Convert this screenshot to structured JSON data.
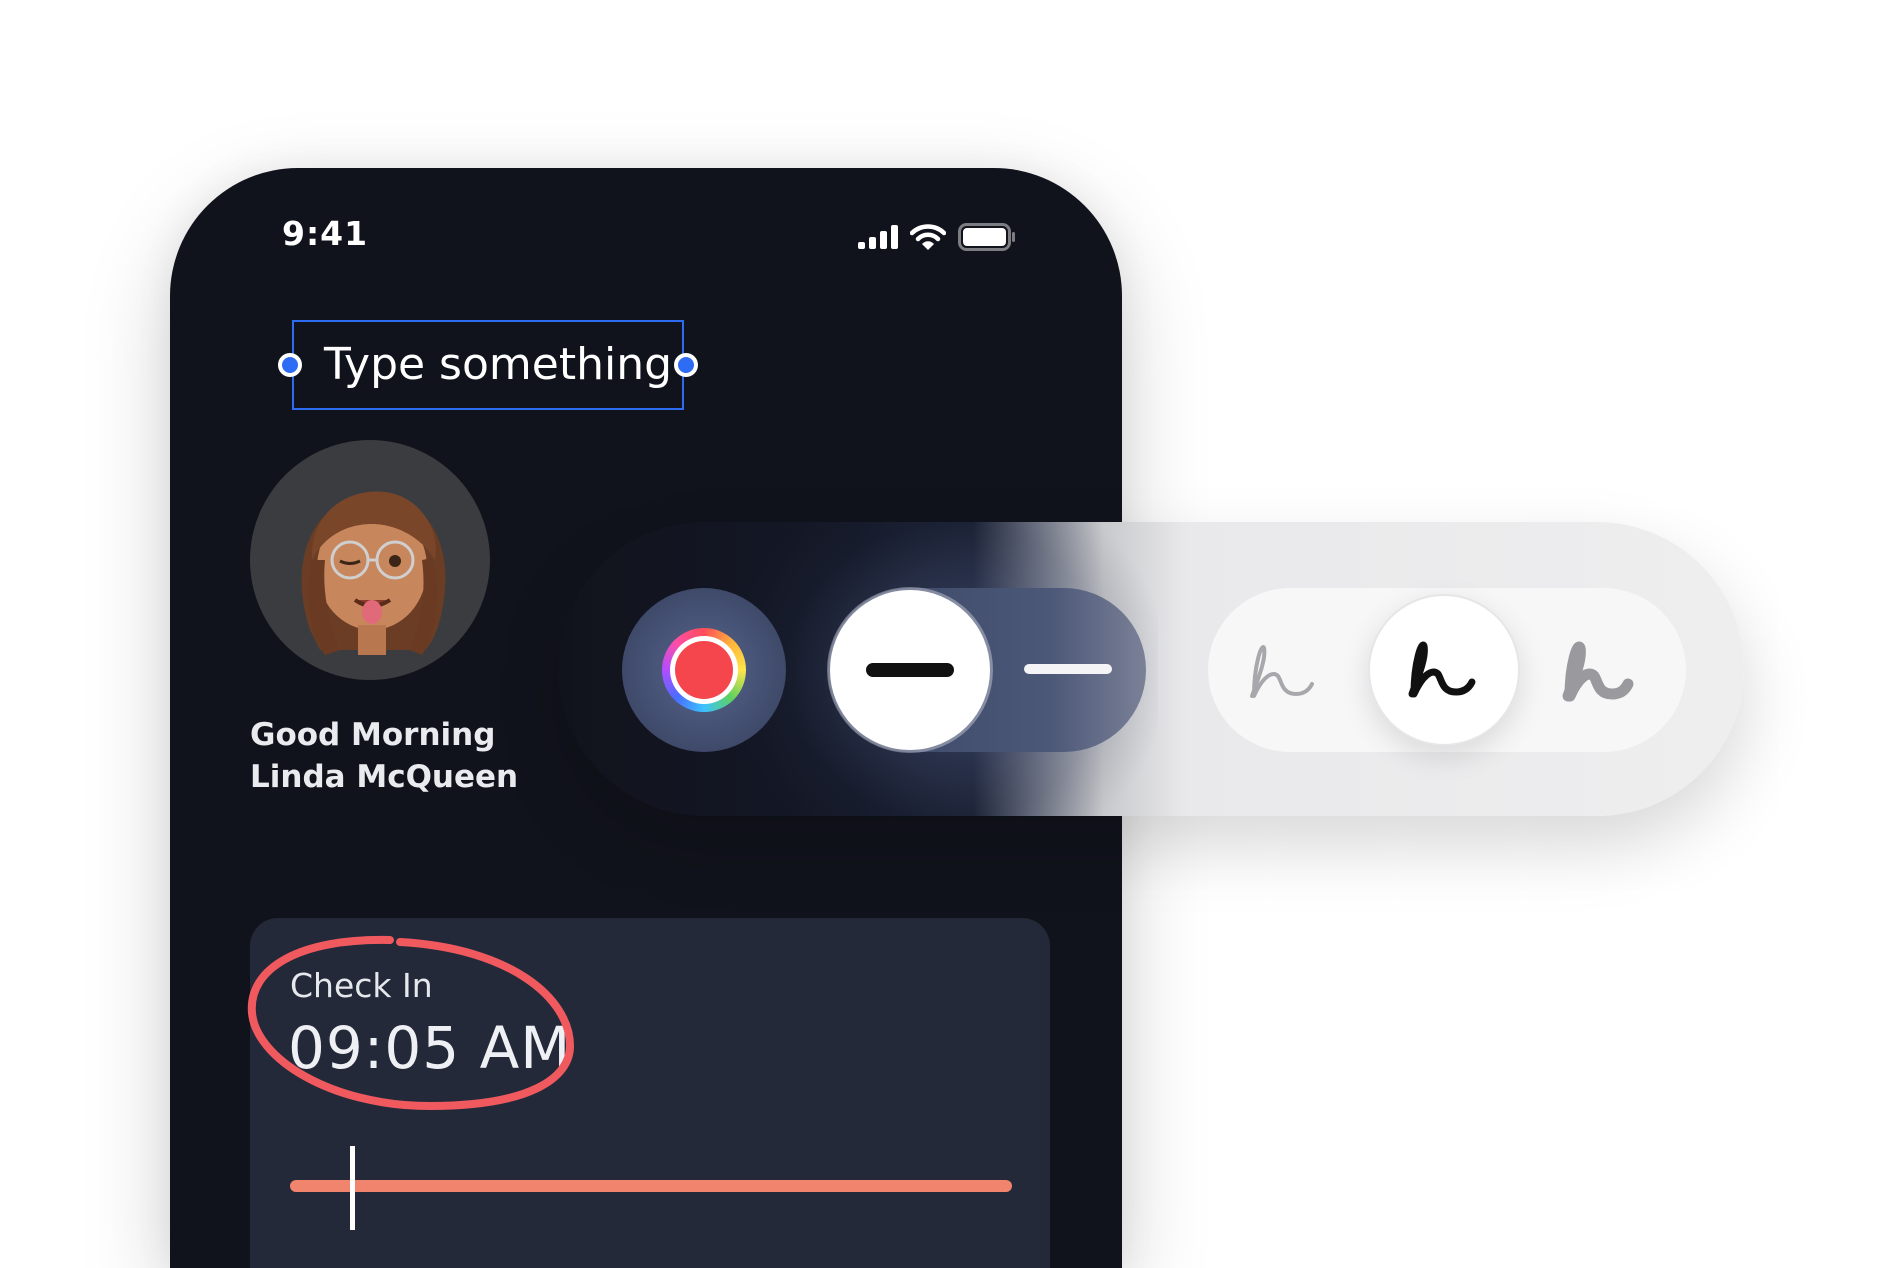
{
  "status_bar": {
    "time": "9:41",
    "icons": [
      "cellular-signal-icon",
      "wifi-icon",
      "battery-icon"
    ]
  },
  "annotation": {
    "text_box": "Type something",
    "accent_color": "#2F6CF6",
    "markup_color": "#F05A5F"
  },
  "profile": {
    "greeting_line1": "Good Morning",
    "greeting_line2": "Linda McQueen"
  },
  "checkin": {
    "label": "Check In",
    "time": "09:05 AM",
    "progress_color": "#F0846D"
  },
  "toolbar": {
    "color_picker": {
      "selected_color": "#F5464D"
    },
    "stroke_widths": [
      "thick",
      "thin"
    ],
    "selected_width": "thick",
    "brush_styles": [
      "pencil",
      "pen",
      "marker"
    ],
    "selected_brush": "pen"
  }
}
